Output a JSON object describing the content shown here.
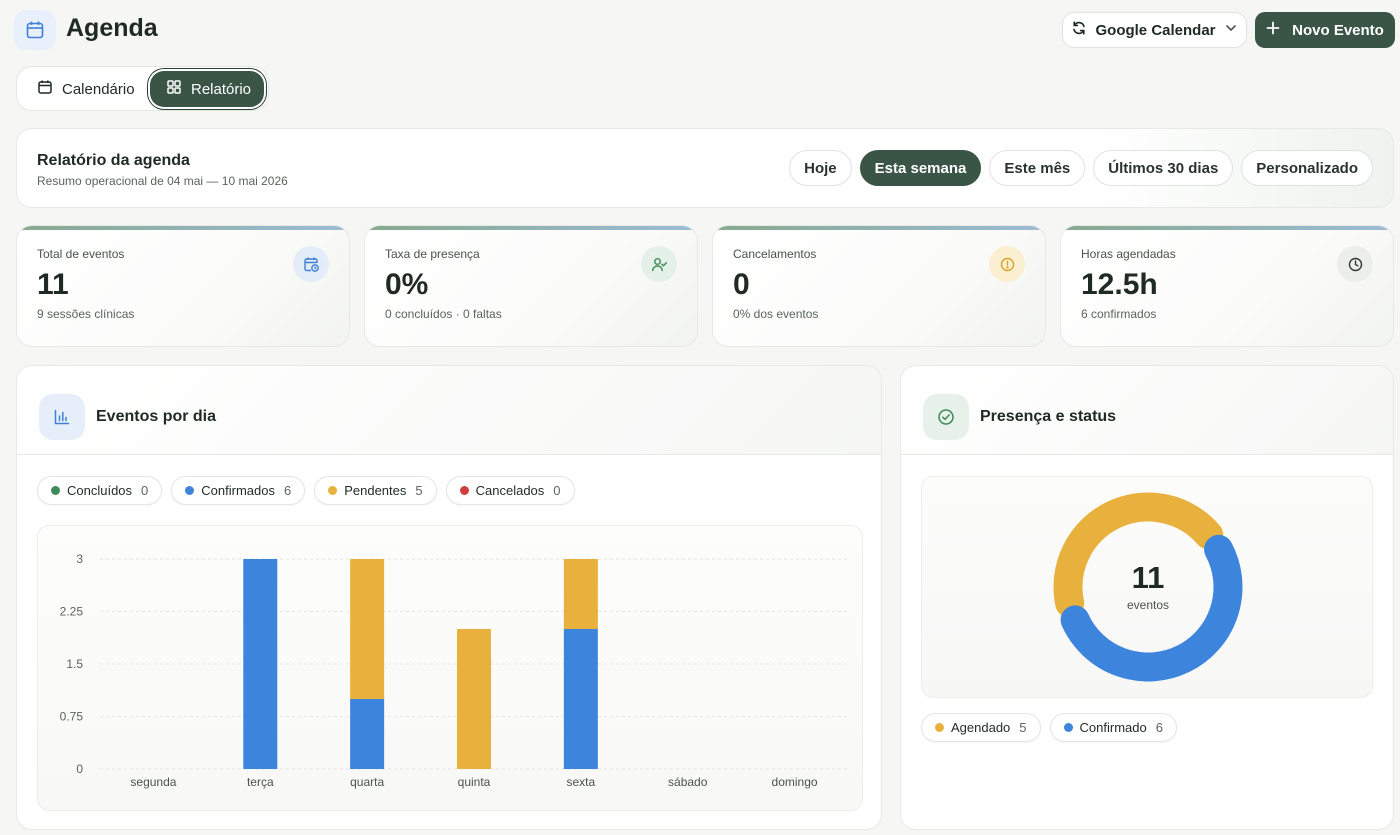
{
  "header": {
    "title": "Agenda",
    "calendar_source": "Google Calendar",
    "new_event_label": "Novo Evento"
  },
  "view_tabs": [
    {
      "label": "Calendário",
      "active": false
    },
    {
      "label": "Relatório",
      "active": true
    }
  ],
  "report": {
    "title": "Relatório da agenda",
    "subtitle": "Resumo operacional de 04 mai — 10 mai 2026",
    "ranges": [
      {
        "label": "Hoje",
        "active": false
      },
      {
        "label": "Esta semana",
        "active": true
      },
      {
        "label": "Este mês",
        "active": false
      },
      {
        "label": "Últimos 30 dias",
        "active": false
      },
      {
        "label": "Personalizado",
        "active": false
      }
    ]
  },
  "stats": [
    {
      "label": "Total de eventos",
      "value": "11",
      "sub": "9 sessões clínicas",
      "icon": "calendar-clock-icon",
      "icon_bg": "#e3edf9",
      "icon_color": "#3f7fd6"
    },
    {
      "label": "Taxa de presença",
      "value": "0%",
      "sub": "0 concluídos · 0 faltas",
      "icon": "user-check-icon",
      "icon_bg": "#e4f1e8",
      "icon_color": "#3f8a5a"
    },
    {
      "label": "Cancelamentos",
      "value": "0",
      "sub": "0% dos eventos",
      "icon": "alert-circle-icon",
      "icon_bg": "#fbefd2",
      "icon_color": "#d9a227"
    },
    {
      "label": "Horas agendadas",
      "value": "12.5h",
      "sub": "6 confirmados",
      "icon": "clock-icon",
      "icon_bg": "#eceeeb",
      "icon_color": "#2f3a33"
    }
  ],
  "events_panel": {
    "title": "Eventos por dia",
    "legend": [
      {
        "label": "Concluídos",
        "count": "0",
        "color": "#3f8a5a"
      },
      {
        "label": "Confirmados",
        "count": "6",
        "color": "#3d84dc"
      },
      {
        "label": "Pendentes",
        "count": "5",
        "color": "#e8b13e"
      },
      {
        "label": "Cancelados",
        "count": "0",
        "color": "#cf3f3f"
      }
    ]
  },
  "status_panel": {
    "title": "Presença e status",
    "center_value": "11",
    "center_label": "eventos",
    "legend": [
      {
        "label": "Agendado",
        "count": "5",
        "color": "#e8b13e"
      },
      {
        "label": "Confirmado",
        "count": "6",
        "color": "#3d84dc"
      }
    ]
  },
  "chart_data": [
    {
      "type": "bar",
      "stacked": true,
      "categories": [
        "segunda",
        "terça",
        "quarta",
        "quinta",
        "sexta",
        "sábado",
        "domingo"
      ],
      "series": [
        {
          "name": "Confirmados",
          "color": "#3d84dc",
          "values": [
            0,
            3,
            1,
            0,
            2,
            0,
            0
          ]
        },
        {
          "name": "Pendentes",
          "color": "#e8b13e",
          "values": [
            0,
            0,
            2,
            2,
            1,
            0,
            0
          ]
        }
      ],
      "yticks": [
        "0",
        "0.75",
        "1.5",
        "2.25",
        "3"
      ],
      "ylim": [
        0,
        3
      ],
      "grid": true
    },
    {
      "type": "pie",
      "donut": true,
      "categories": [
        "Agendado",
        "Confirmado"
      ],
      "values": [
        5,
        6
      ],
      "colors": [
        "#e8b13e",
        "#3d84dc"
      ]
    }
  ]
}
